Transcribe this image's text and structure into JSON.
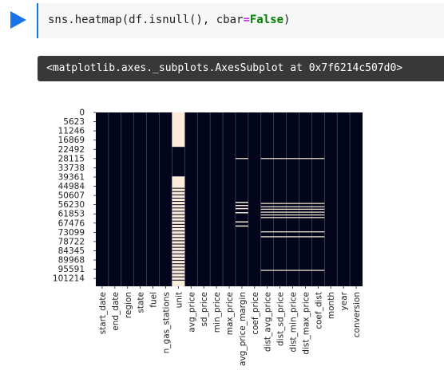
{
  "cell": {
    "code_prefix": "sns.heatmap(df.isnull(), cbar",
    "code_equals": "=",
    "code_false": "False",
    "code_suffix": ")"
  },
  "output": {
    "text": "<matplotlib.axes._subplots.AxesSubplot at 0x7f6214c507d0>"
  },
  "colors": {
    "not_null": "#03051a",
    "null": "#faebdd",
    "run_button": "#1a73e8"
  },
  "chart_data": {
    "type": "heatmap",
    "title": "",
    "xlabel": "",
    "ylabel": "",
    "ylim": [
      0,
      106000
    ],
    "yticklabels": [
      "0",
      "5623",
      "11246",
      "16869",
      "22492",
      "28115",
      "33738",
      "39361",
      "44984",
      "50607",
      "56230",
      "61853",
      "67476",
      "73099",
      "78722",
      "84345",
      "89968",
      "95591",
      "101214"
    ],
    "columns": [
      "start_date",
      "end_date",
      "region",
      "state",
      "fuel",
      "n_gas_stations",
      "unit",
      "avg_price",
      "sd_price",
      "min_price",
      "max_price",
      "avg_price_margin",
      "coef_price",
      "dist_avg_price",
      "dist_sd_price",
      "dist_min_price",
      "dist_max_price",
      "coef_dist",
      "month",
      "year",
      "conversion"
    ],
    "null_segments": {
      "unit": [
        [
          0,
          21000
        ],
        [
          39000,
          46000
        ],
        [
          46500,
          48000
        ],
        [
          48500,
          50000
        ],
        [
          50500,
          52000
        ],
        [
          52500,
          54000
        ],
        [
          54500,
          56000
        ],
        [
          56500,
          58000
        ],
        [
          58500,
          60000
        ],
        [
          60500,
          62000
        ],
        [
          62500,
          64000
        ],
        [
          64500,
          66000
        ],
        [
          66500,
          68000
        ],
        [
          68500,
          70000
        ],
        [
          70500,
          72000
        ],
        [
          72500,
          74000
        ],
        [
          74500,
          76000
        ],
        [
          76500,
          78000
        ],
        [
          78500,
          80000
        ],
        [
          80500,
          82000
        ],
        [
          82500,
          84000
        ],
        [
          84500,
          86000
        ],
        [
          86500,
          88000
        ],
        [
          88500,
          90000
        ],
        [
          90500,
          92000
        ],
        [
          92500,
          94000
        ],
        [
          94500,
          96000
        ],
        [
          96500,
          98000
        ],
        [
          98500,
          100000
        ],
        [
          100500,
          102000
        ],
        [
          102500,
          106000
        ]
      ],
      "avg_price_margin": [
        [
          27800,
          28400
        ],
        [
          54500,
          55200
        ],
        [
          56400,
          57100
        ],
        [
          58300,
          59000
        ],
        [
          60800,
          61500
        ],
        [
          66400,
          67100
        ],
        [
          68900,
          69600
        ]
      ],
      "dist_avg_price": [
        [
          27800,
          28400
        ],
        [
          55200,
          55800
        ],
        [
          57200,
          57800
        ],
        [
          58700,
          59300
        ],
        [
          60500,
          61100
        ],
        [
          62200,
          62800
        ],
        [
          63800,
          64400
        ],
        [
          72500,
          73100
        ],
        [
          75500,
          76100
        ],
        [
          96000,
          96600
        ]
      ],
      "dist_sd_price": [
        [
          27800,
          28400
        ],
        [
          55200,
          55800
        ],
        [
          57200,
          57800
        ],
        [
          58700,
          59300
        ],
        [
          60500,
          61100
        ],
        [
          62200,
          62800
        ],
        [
          63800,
          64400
        ],
        [
          72500,
          73100
        ],
        [
          75500,
          76100
        ],
        [
          96000,
          96600
        ]
      ],
      "dist_min_price": [
        [
          27800,
          28400
        ],
        [
          55200,
          55800
        ],
        [
          57200,
          57800
        ],
        [
          58700,
          59300
        ],
        [
          60500,
          61100
        ],
        [
          62200,
          62800
        ],
        [
          63800,
          64400
        ],
        [
          72500,
          73100
        ],
        [
          75500,
          76100
        ],
        [
          96000,
          96600
        ]
      ],
      "dist_max_price": [
        [
          27800,
          28400
        ],
        [
          55200,
          55800
        ],
        [
          57200,
          57800
        ],
        [
          58700,
          59300
        ],
        [
          60500,
          61100
        ],
        [
          62200,
          62800
        ],
        [
          63800,
          64400
        ],
        [
          72500,
          73100
        ],
        [
          75500,
          76100
        ],
        [
          96000,
          96600
        ]
      ],
      "coef_dist": [
        [
          27800,
          28400
        ],
        [
          55200,
          55800
        ],
        [
          57200,
          57800
        ],
        [
          58700,
          59300
        ],
        [
          60500,
          61100
        ],
        [
          62200,
          62800
        ],
        [
          63800,
          64400
        ],
        [
          72500,
          73100
        ],
        [
          75500,
          76100
        ],
        [
          96000,
          96600
        ]
      ]
    }
  }
}
